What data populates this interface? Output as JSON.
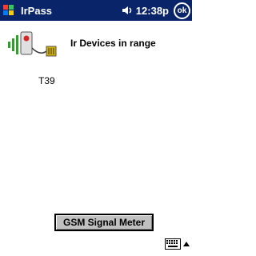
{
  "titlebar": {
    "app_title": "IrPass",
    "clock": "12:38p",
    "ok_label": "ok",
    "start_icon": "windows-flag-icon",
    "speaker_icon": "speaker-icon",
    "color": "#0a246a"
  },
  "main": {
    "header": "Ir Devices in range",
    "device_icon": "infrared-device-icon",
    "devices": [
      {
        "name": "T39"
      }
    ]
  },
  "buttons": {
    "gsm_signal_meter": "GSM Signal Meter"
  },
  "bottom": {
    "keyboard_icon": "keyboard-icon",
    "sip_arrow_icon": "up-arrow-icon"
  }
}
